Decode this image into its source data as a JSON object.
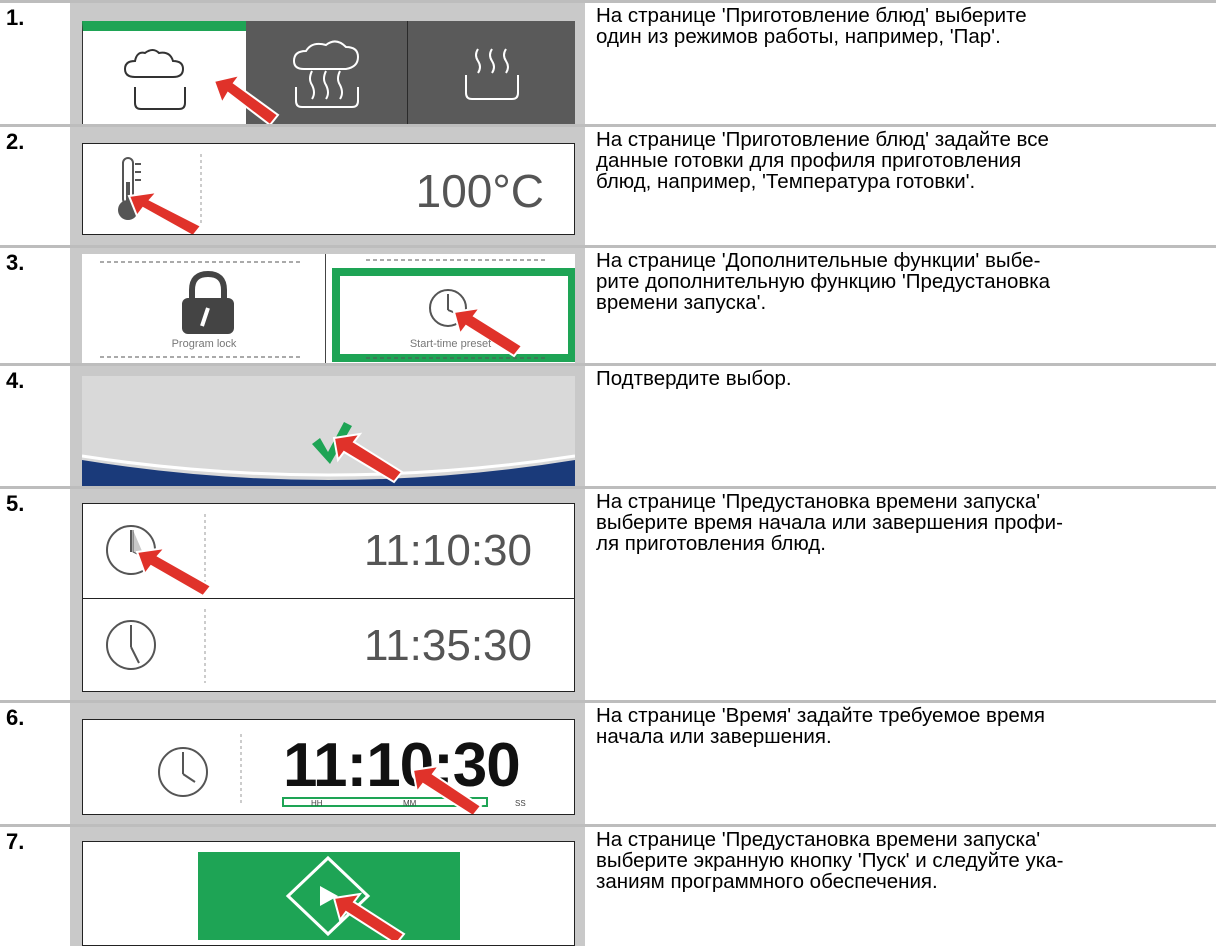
{
  "steps": [
    {
      "number": "1.",
      "lines": [
        "На странице 'Приготовление блюд' выберите",
        "один из режимов работы, например, 'Пар'."
      ]
    },
    {
      "number": "2.",
      "lines": [
        "На странице 'Приготовление блюд' задайте все",
        "данные готовки для профиля приготовления",
        "блюд, например, 'Температура готовки'."
      ],
      "value": "100°C"
    },
    {
      "number": "3.",
      "lines": [
        "На странице 'Дополнительные функции' выбе-",
        "рите дополнительную функцию 'Предустановка",
        "времени запуска'."
      ],
      "tile_left": "Program lock",
      "tile_right": "Start-time preset"
    },
    {
      "number": "4.",
      "lines": [
        "Подтвердите выбор."
      ]
    },
    {
      "number": "5.",
      "lines": [
        "На странице 'Предустановка времени запуска'",
        "выберите время начала или завершения профи-",
        "ля приготовления блюд."
      ],
      "time_start": "11:10:30",
      "time_end": "11:35:30"
    },
    {
      "number": "6.",
      "lines": [
        "На странице 'Время' задайте требуемое время",
        "начала или завершения."
      ],
      "time": "11:10:30",
      "hh": "HH",
      "mm": "MM",
      "ss": "SS"
    },
    {
      "number": "7.",
      "lines": [
        "На странице 'Предустановка времени запуска'",
        "выберите экранную кнопку 'Пуск' и следуйте ука-",
        "заниям программного обеспечения."
      ]
    }
  ],
  "colors": {
    "accent_green": "#1ea455",
    "arrow_red": "#e0322a",
    "dark_tab": "#5a5a5a",
    "navy": "#1a3a7a"
  },
  "icons": [
    "cloud-pot-icon",
    "steam-pot-icon",
    "heat-pot-icon",
    "thermometer-icon",
    "padlock-icon",
    "clock-icon",
    "checkmark-icon",
    "start-play-icon",
    "pointer-arrow-icon"
  ]
}
